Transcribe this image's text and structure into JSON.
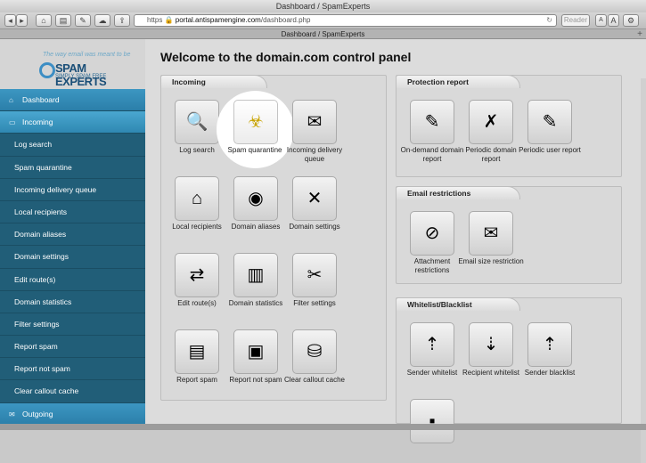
{
  "browser": {
    "window_title": "Dashboard / SpamExperts",
    "url_host": "portal.antispamengine.com",
    "url_path": "/dashboard.php",
    "url_scheme": "https",
    "reader_label": "Reader",
    "font_small": "A",
    "font_large": "A",
    "tab_title": "Dashboard / SpamExperts",
    "tab_plus": "+"
  },
  "brand": {
    "slogan": "The way email was meant to be",
    "name": "SPAM EXPERTS",
    "tagline": "SIMPLY SPAM FREE"
  },
  "sidebar": {
    "items": [
      {
        "label": "Dashboard",
        "icon": "home-icon",
        "glyph": "⌂"
      },
      {
        "label": "Incoming",
        "icon": "inbox-icon",
        "glyph": "▭"
      },
      {
        "label": "Log search"
      },
      {
        "label": "Spam quarantine"
      },
      {
        "label": "Incoming delivery queue"
      },
      {
        "label": "Local recipients"
      },
      {
        "label": "Domain aliases"
      },
      {
        "label": "Domain settings"
      },
      {
        "label": "Edit route(s)"
      },
      {
        "label": "Domain statistics"
      },
      {
        "label": "Filter settings"
      },
      {
        "label": "Report spam"
      },
      {
        "label": "Report not spam"
      },
      {
        "label": "Clear callout cache"
      },
      {
        "label": "Outgoing",
        "icon": "mail-icon",
        "glyph": "✉"
      }
    ]
  },
  "main": {
    "title": "Welcome to the domain.com control panel",
    "incoming": {
      "heading": "Incoming",
      "tiles": [
        {
          "label": "Log search",
          "icon": "magnifier-icon",
          "glyph": "🔍"
        },
        {
          "label": "Spam quarantine",
          "icon": "biohazard-icon",
          "glyph": "☣"
        },
        {
          "label": "Incoming delivery queue",
          "icon": "mail-queue-icon",
          "glyph": "✉"
        },
        {
          "label": "Local recipients",
          "icon": "house-icon",
          "glyph": "⌂"
        },
        {
          "label": "Domain aliases",
          "icon": "globe-icon",
          "glyph": "◉"
        },
        {
          "label": "Domain settings",
          "icon": "tools-icon",
          "glyph": "✕"
        },
        {
          "label": "Edit route(s)",
          "icon": "arrows-icon",
          "glyph": "⇄"
        },
        {
          "label": "Domain statistics",
          "icon": "statistics-icon",
          "glyph": "▥"
        },
        {
          "label": "Filter settings",
          "icon": "filter-tools-icon",
          "glyph": "✂"
        },
        {
          "label": "Report spam",
          "icon": "report-spam-icon",
          "glyph": "▤"
        },
        {
          "label": "Report not spam",
          "icon": "report-not-spam-icon",
          "glyph": "▣"
        },
        {
          "label": "Clear callout cache",
          "icon": "database-icon",
          "glyph": "⛁"
        }
      ]
    },
    "protection": {
      "heading": "Protection report",
      "tiles": [
        {
          "label": "On-demand domain report",
          "icon": "pdf-icon",
          "glyph": "✎"
        },
        {
          "label": "Periodic domain report",
          "icon": "pdf-cross-icon",
          "glyph": "✗"
        },
        {
          "label": "Periodic user report",
          "icon": "pdf-user-icon",
          "glyph": "✎"
        }
      ]
    },
    "restrictions": {
      "heading": "Email restrictions",
      "tiles": [
        {
          "label": "Attachment restrictions",
          "icon": "paperclip-icon",
          "glyph": "⊘"
        },
        {
          "label": "Email size restriction",
          "icon": "envelope-icon",
          "glyph": "✉"
        }
      ]
    },
    "whitelist": {
      "heading": "Whitelist/Blacklist",
      "tiles": [
        {
          "label": "Sender whitelist",
          "icon": "arrow-up-doc-icon",
          "glyph": "⇡"
        },
        {
          "label": "Recipient whitelist",
          "icon": "arrow-down-doc-icon",
          "glyph": "⇣"
        },
        {
          "label": "Sender blacklist",
          "icon": "black-doc-icon",
          "glyph": "⇡"
        },
        {
          "label": "",
          "icon": "black-doc-icon",
          "glyph": "▪"
        }
      ]
    }
  },
  "colors": {
    "sidebar_dark": "#215e78",
    "sidebar_light": "#3c97c2",
    "page_bg": "#dcdcdc"
  }
}
